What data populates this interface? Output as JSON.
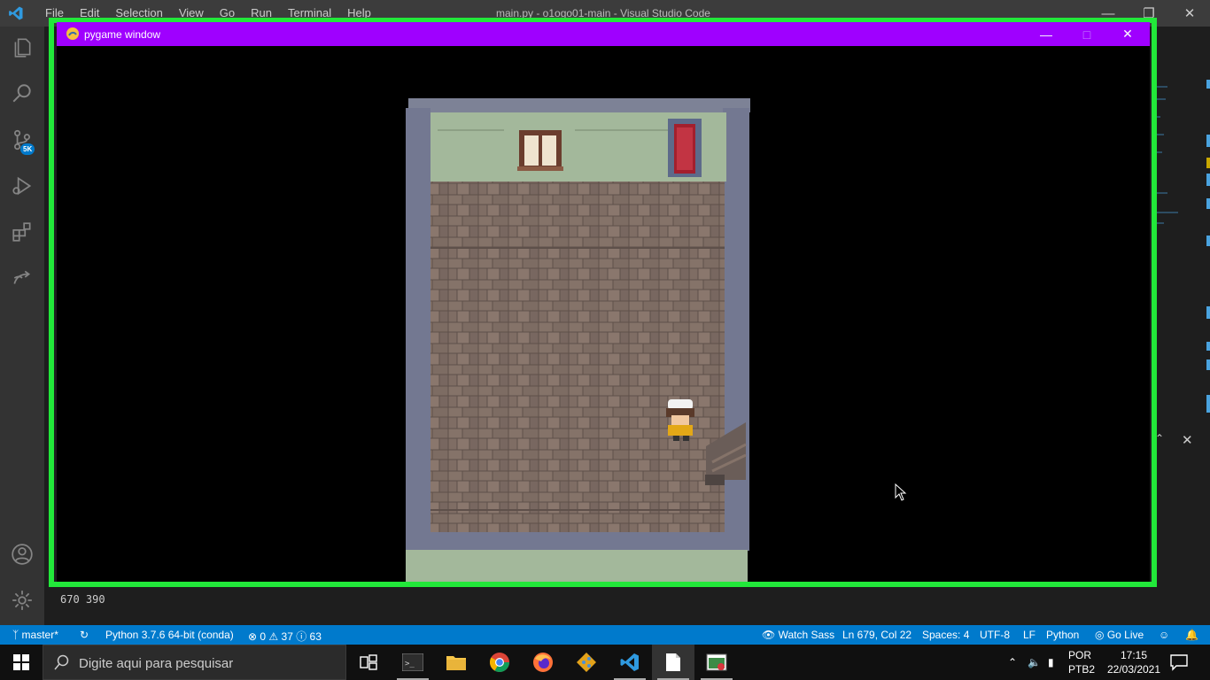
{
  "vscode": {
    "menu": [
      "File",
      "Edit",
      "Selection",
      "View",
      "Go",
      "Run",
      "Terminal",
      "Help"
    ],
    "window_title": "main.py - o1ogo01-main - Visual Studio Code",
    "source_control_badge": "5K",
    "output_line": "670 390"
  },
  "pygame": {
    "title": "pygame window"
  },
  "statusbar": {
    "branch": "master*",
    "interpreter": "Python 3.7.6 64-bit (conda)",
    "errors": "0",
    "warnings": "37",
    "infos": "63",
    "watch_sass": "Watch Sass",
    "cursor_pos": "Ln 679, Col 22",
    "spaces": "Spaces: 4",
    "encoding": "UTF-8",
    "eol": "LF",
    "language": "Python",
    "go_live": "Go Live"
  },
  "taskbar": {
    "search_placeholder": "Digite aqui para pesquisar",
    "lang_line1": "POR",
    "lang_line2": "PTB2",
    "time": "17:15",
    "date": "22/03/2021"
  },
  "colors": {
    "frame_green": "#22e83a",
    "pygame_titlebar": "#9f00ff",
    "statusbar": "#007acc"
  }
}
